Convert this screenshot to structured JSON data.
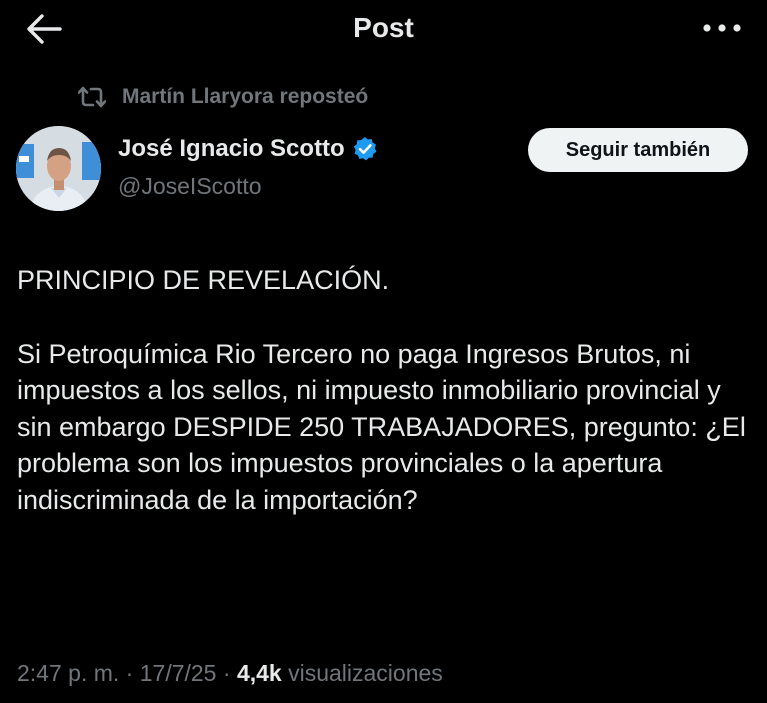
{
  "header": {
    "title": "Post",
    "back_icon": "arrow-left-icon",
    "more_icon": "more-horizontal-icon"
  },
  "repost": {
    "label": "Martín Llaryora reposteó",
    "icon": "repost-icon"
  },
  "author": {
    "name": "José Ignacio Scotto",
    "handle": "@JoseIScotto",
    "verified_color": "#1d9bf0",
    "follow_label": "Seguir también"
  },
  "post": {
    "heading": "PRINCIPIO DE REVELACIÓN.",
    "body": "Si Petroquímica Rio Tercero no paga Ingresos Brutos, ni impuestos a los sellos, ni impuesto inmobiliario provincial y sin embargo DESPIDE 250 TRABAJADORES, pregunto: ¿El problema son los impuestos provinciales o la apertura indiscriminada de la importación?"
  },
  "meta": {
    "time": "2:47 p. m.",
    "separator": "·",
    "date": "17/7/25",
    "views_count": "4,4k",
    "views_label": "visualizaciones"
  },
  "colors": {
    "background": "#000000",
    "text": "#e7e9ea",
    "muted": "#71767b",
    "accent": "#1d9bf0"
  }
}
